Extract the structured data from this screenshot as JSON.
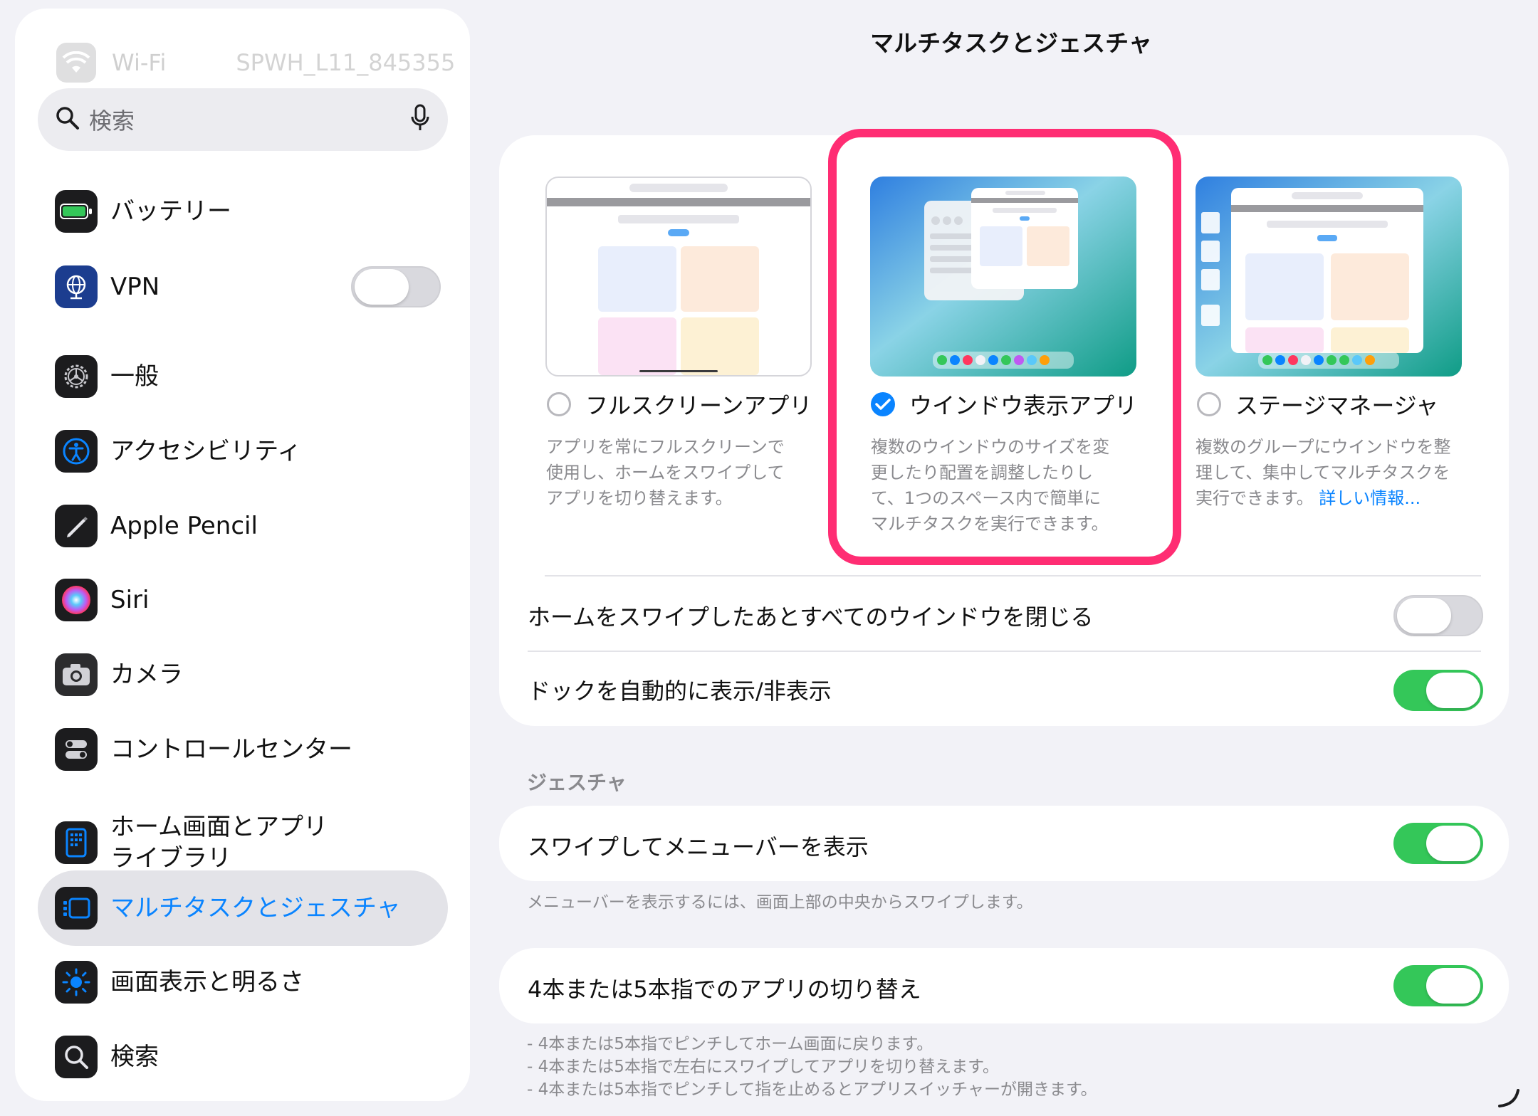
{
  "sidebar": {
    "wifi": {
      "label": "Wi-Fi",
      "value": "SPWH_L11_845355",
      "icon": "wifi-icon"
    },
    "search": {
      "placeholder": "検索",
      "icon": "search-icon",
      "mic_icon": "microphone-icon"
    },
    "items": [
      {
        "label": "バッテリー",
        "icon": "battery-icon"
      },
      {
        "label": "VPN",
        "icon": "vpn-globe-icon",
        "toggle": false
      },
      {
        "label": "一般",
        "icon": "gear-icon"
      },
      {
        "label": "アクセシビリティ",
        "icon": "accessibility-icon"
      },
      {
        "label": "Apple Pencil",
        "icon": "pencil-icon"
      },
      {
        "label": "Siri",
        "icon": "siri-icon"
      },
      {
        "label": "カメラ",
        "icon": "camera-icon"
      },
      {
        "label": "コントロールセンター",
        "icon": "control-center-icon"
      },
      {
        "label": "ホーム画面とアプリ",
        "label2": "ライブラリ",
        "icon": "home-screen-icon"
      },
      {
        "label": "マルチタスクとジェスチャ",
        "icon": "multitasking-icon",
        "selected": true
      },
      {
        "label": "画面表示と明るさ",
        "icon": "brightness-icon"
      },
      {
        "label": "検索",
        "icon": "search-icon"
      }
    ]
  },
  "main": {
    "title": "マルチタスクとジェスチャ",
    "options": [
      {
        "label": "フルスクリーンアプリ",
        "selected": false,
        "desc_lines": [
          "アプリを常にフルスクリーンで",
          "使用し、ホームをスワイプして",
          "アプリを切り替えます。"
        ]
      },
      {
        "label": "ウインドウ表示アプリ",
        "selected": true,
        "desc_lines": [
          "複数のウインドウのサイズを変",
          "更したり配置を調整したりし",
          "て、1つのスペース内で簡単に",
          "マルチタスクを実行できます。"
        ]
      },
      {
        "label": "ステージマネージャ",
        "selected": false,
        "desc_lines": [
          "複数のグループにウインドウを整",
          "理して、集中してマルチタスクを",
          "実行できます。"
        ],
        "link": "詳しい情報..."
      }
    ],
    "toggles": [
      {
        "label": "ホームをスワイプしたあとすべてのウインドウを閉じる",
        "on": false
      },
      {
        "label": "ドックを自動的に表示/非表示",
        "on": true
      }
    ],
    "gestures_header": "ジェスチャ",
    "menu_bar_toggle": {
      "label": "スワイプしてメニューバーを表示",
      "on": true
    },
    "menu_bar_footer": "メニューバーを表示するには、画面上部の中央からスワイプします。",
    "app_switch_toggle": {
      "label": "4本または5本指でのアプリの切り替え",
      "on": true
    },
    "app_switch_footer": [
      "- 4本または5本指でピンチしてホーム画面に戻ります。",
      "- 4本または5本指で左右にスワイプしてアプリを切り替えます。",
      "- 4本または5本指でピンチして指を止めるとアプリスイッチャーが開きます。"
    ]
  },
  "colors": {
    "accent": "#0a84ff",
    "toggle_on": "#34c759",
    "highlight": "#ff2d73"
  }
}
